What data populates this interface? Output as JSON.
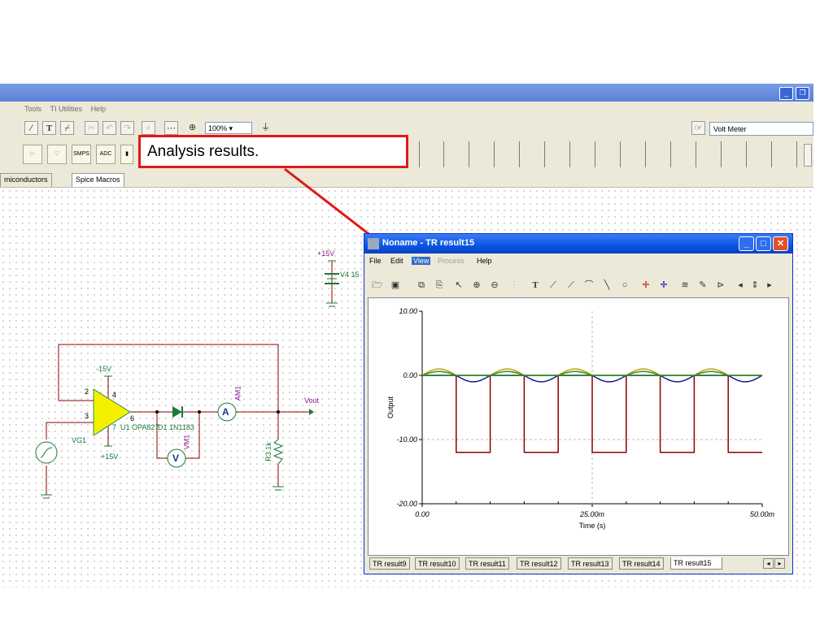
{
  "app": {
    "menu": [
      "Tools",
      "TI Utilities",
      "Help"
    ],
    "zoom": "100%",
    "meter_select": "Volt Meter",
    "component_labels": [
      "SMPS",
      "ADC"
    ],
    "tabs": [
      "miconductors",
      "Spice Macros"
    ]
  },
  "callout": {
    "text": "Analysis results."
  },
  "schematic": {
    "v_neg": "-15V",
    "v_pos": "+15V",
    "v_pos_bottom": "+15V",
    "v4_label": "V4 15",
    "pin2": "2",
    "pin3": "3",
    "pin4": "4",
    "pin6": "6",
    "pin7": "7",
    "opamp": "U1 OPA827",
    "diode": "D1 1N1183",
    "vg": "VG1",
    "vm": "VM1",
    "am": "AM1",
    "ammeter": "A",
    "voltmeter": "V",
    "resistor": "R3 1k",
    "out": "Vout"
  },
  "window": {
    "title": "Noname - TR result15",
    "menu": [
      "File",
      "Edit",
      "View",
      "Process",
      "Help"
    ],
    "tabs": [
      "TR result9",
      "TR result10",
      "TR result11",
      "TR result12",
      "TR result13",
      "TR result14",
      "TR result15"
    ],
    "active_tab": "TR result15"
  },
  "chart_data": {
    "type": "line",
    "xlabel": "Time (s)",
    "ylabel": "Output",
    "xlim": [
      0,
      0.05
    ],
    "ylim": [
      -20,
      10
    ],
    "xticks": [
      "0.00",
      "25.00m",
      "50.00m"
    ],
    "yticks": [
      "10.00",
      "0.00",
      "-10.00",
      "-20.00"
    ],
    "grid": "dashed center lines",
    "series": [
      {
        "color": "#8b0000",
        "shape": "square wave",
        "points": [
          [
            0,
            0
          ],
          [
            0.005,
            0
          ],
          [
            0.005,
            -12
          ],
          [
            0.01,
            -12
          ],
          [
            0.01,
            0
          ],
          [
            0.015,
            0
          ],
          [
            0.015,
            -12
          ],
          [
            0.02,
            -12
          ],
          [
            0.02,
            0
          ],
          [
            0.025,
            0
          ],
          [
            0.025,
            -12
          ],
          [
            0.03,
            -12
          ],
          [
            0.03,
            0
          ],
          [
            0.035,
            0
          ],
          [
            0.035,
            -12
          ],
          [
            0.04,
            -12
          ],
          [
            0.04,
            0
          ],
          [
            0.045,
            0
          ],
          [
            0.045,
            -12
          ],
          [
            0.05,
            -12
          ]
        ]
      },
      {
        "color": "#1a1a8c",
        "shape": "sine",
        "amplitude": 1,
        "period": 0.01
      },
      {
        "color": "#c8a000",
        "shape": "half-wave positive",
        "amplitude": 1,
        "period": 0.01
      },
      {
        "color": "#2e8b2e",
        "shape": "rectified",
        "amplitude": 0.6,
        "period": 0.01
      }
    ]
  }
}
